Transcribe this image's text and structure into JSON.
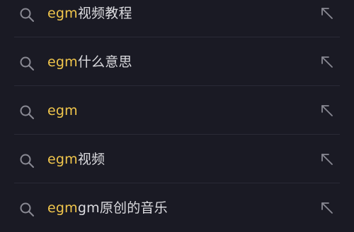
{
  "colors": {
    "background": "#1a1a24",
    "highlight": "#f1c64c",
    "text": "#dcdce0",
    "icon": "#8a8a94",
    "divider": "#2a2a36"
  },
  "suggestions": [
    {
      "match": "egm",
      "rest": "视频教程",
      "icon": "search-icon",
      "action_icon": "arrow-up-left-icon"
    },
    {
      "match": "egm",
      "rest": "什么意思",
      "icon": "search-icon",
      "action_icon": "arrow-up-left-icon"
    },
    {
      "match": "egm",
      "rest": "",
      "icon": "search-icon",
      "action_icon": "arrow-up-left-icon"
    },
    {
      "match": "egm",
      "rest": "视频",
      "icon": "search-icon",
      "action_icon": "arrow-up-left-icon"
    },
    {
      "match": "egm",
      "rest": "gm原创的音乐",
      "icon": "search-icon",
      "action_icon": "arrow-up-left-icon"
    }
  ]
}
